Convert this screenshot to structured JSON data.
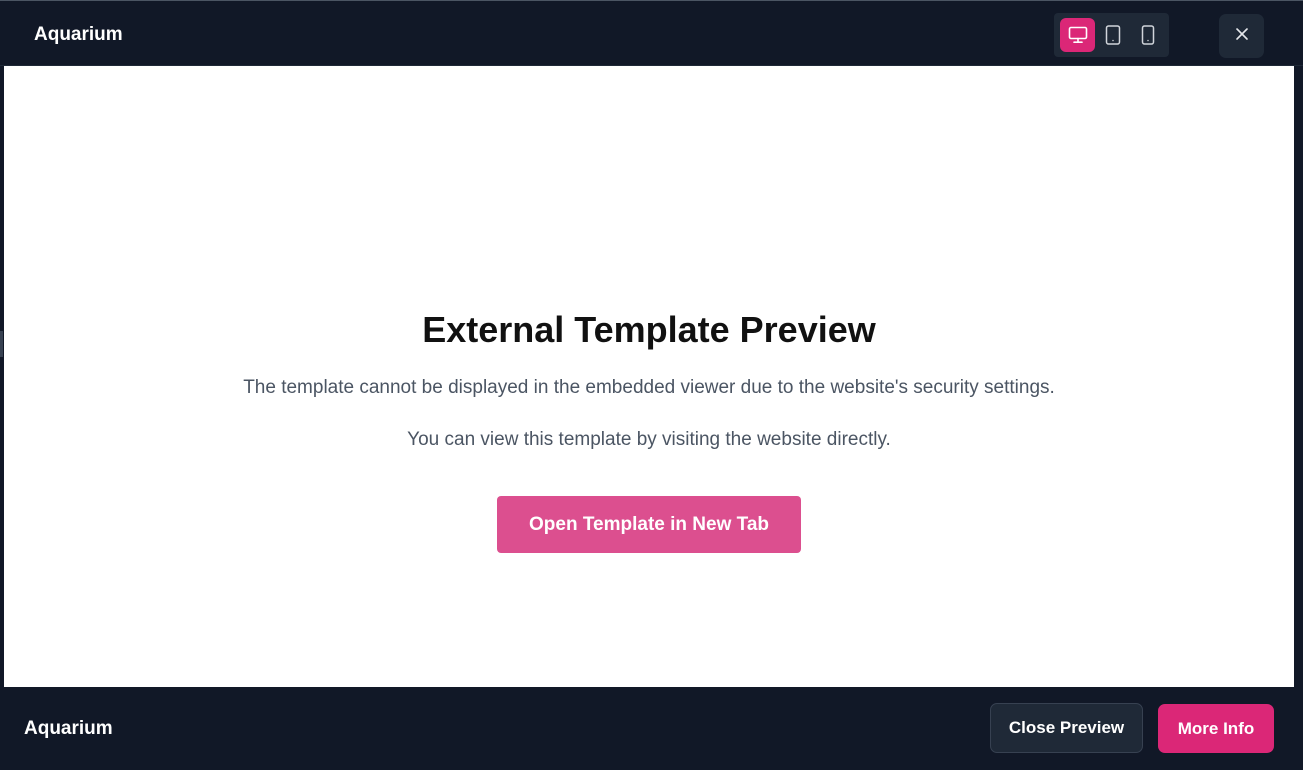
{
  "header": {
    "title": "Aquarium",
    "device_toggle": {
      "options": [
        "desktop-icon",
        "tablet-icon",
        "mobile-icon"
      ],
      "active": "desktop-icon"
    },
    "close_icon": "close-icon"
  },
  "content": {
    "heading": "External Template Preview",
    "message_1": "The template cannot be displayed in the embedded viewer due to the website's security settings.",
    "message_2": "You can view this template by visiting the website directly.",
    "open_button_label": "Open Template in New Tab"
  },
  "footer": {
    "title": "Aquarium",
    "close_preview_label": "Close Preview",
    "more_info_label": "More Info"
  },
  "colors": {
    "background_dark": "#111827",
    "surface_dark": "#1f2937",
    "accent_pink": "#db2777",
    "open_button_pink": "#dc4f8f",
    "content_bg": "#ffffff"
  }
}
